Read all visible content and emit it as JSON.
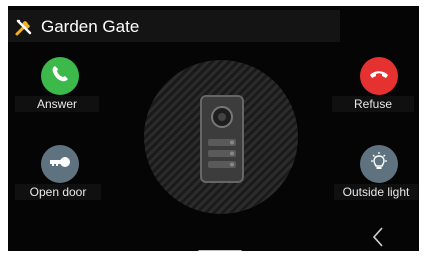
{
  "header": {
    "title": "Garden Gate",
    "icon": "tools-icon"
  },
  "actions": {
    "answer": {
      "label": "Answer",
      "icon": "phone-icon",
      "color": "#3cb94a"
    },
    "refuse": {
      "label": "Refuse",
      "icon": "hangup-icon",
      "color": "#e5312f"
    },
    "open_door": {
      "label": "Open door",
      "icon": "key-icon",
      "color": "#5f7280"
    },
    "outside_light": {
      "label": "Outside light",
      "icon": "light-bulb-icon",
      "color": "#5f7280"
    }
  },
  "center": {
    "icon": "door-station-icon"
  },
  "nav": {
    "back_icon": "chevron-left-icon",
    "home_indicator": "home-indicator"
  }
}
